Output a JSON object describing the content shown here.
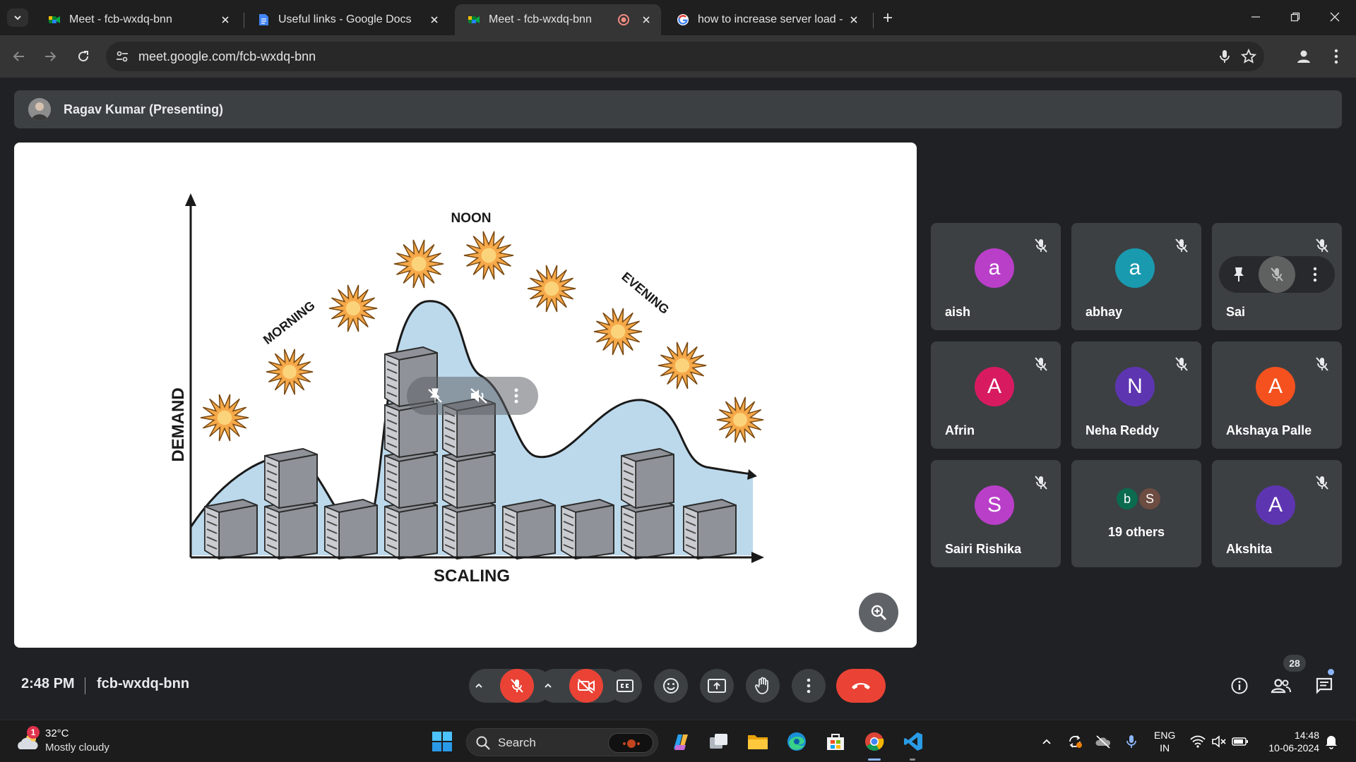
{
  "browser": {
    "tabs": [
      {
        "title": "Meet - fcb-wxdq-bnn",
        "favicon": "meet-icon",
        "active": false
      },
      {
        "title": "Useful links - Google Docs",
        "favicon": "docs-icon",
        "active": false
      },
      {
        "title": "Meet - fcb-wxdq-bnn",
        "favicon": "meet-icon",
        "active": true,
        "recording": true
      },
      {
        "title": "how to increase server load - G",
        "favicon": "google-icon",
        "active": false
      }
    ],
    "url": "meet.google.com/fcb-wxdq-bnn"
  },
  "presenter": {
    "label": "Ragav Kumar (Presenting)"
  },
  "slide": {
    "labels": {
      "demand": "DEMAND",
      "scaling": "SCALING",
      "morning": "MORNING",
      "noon": "NOON",
      "evening": "EVENING"
    }
  },
  "participants": [
    {
      "name": "aish",
      "initial": "a",
      "color": "#b93fc9",
      "muted": true
    },
    {
      "name": "abhay",
      "initial": "a",
      "color": "#1a9aaf",
      "muted": true
    },
    {
      "name": "Sai",
      "initial": "",
      "color": "#3c4043",
      "muted": true,
      "hovered": true
    },
    {
      "name": "Afrin",
      "initial": "A",
      "color": "#d81b60",
      "muted": true
    },
    {
      "name": "Neha Reddy",
      "initial": "N",
      "color": "#5e35b1",
      "muted": true
    },
    {
      "name": "Akshaya Palle",
      "initial": "A",
      "color": "#f4511e",
      "muted": true
    },
    {
      "name": "Sairi Rishika",
      "initial": "S",
      "color": "#b93fc9",
      "muted": true
    },
    {
      "name": "Akshita",
      "initial": "A",
      "color": "#5e35b1",
      "muted": true
    }
  ],
  "others": {
    "label": "19 others",
    "avatars": [
      {
        "initial": "b",
        "color": "#0b6b4f"
      },
      {
        "initial": "S",
        "color": "#6d4c41"
      }
    ]
  },
  "meeting": {
    "time": "2:48 PM",
    "code": "fcb-wxdq-bnn",
    "people_count": "28"
  },
  "taskbar": {
    "weather_badge": "1",
    "temperature": "32°C",
    "condition": "Mostly cloudy",
    "search_label": "Search",
    "lang_top": "ENG",
    "lang_bottom": "IN",
    "time": "14:48",
    "date": "10-06-2024"
  }
}
